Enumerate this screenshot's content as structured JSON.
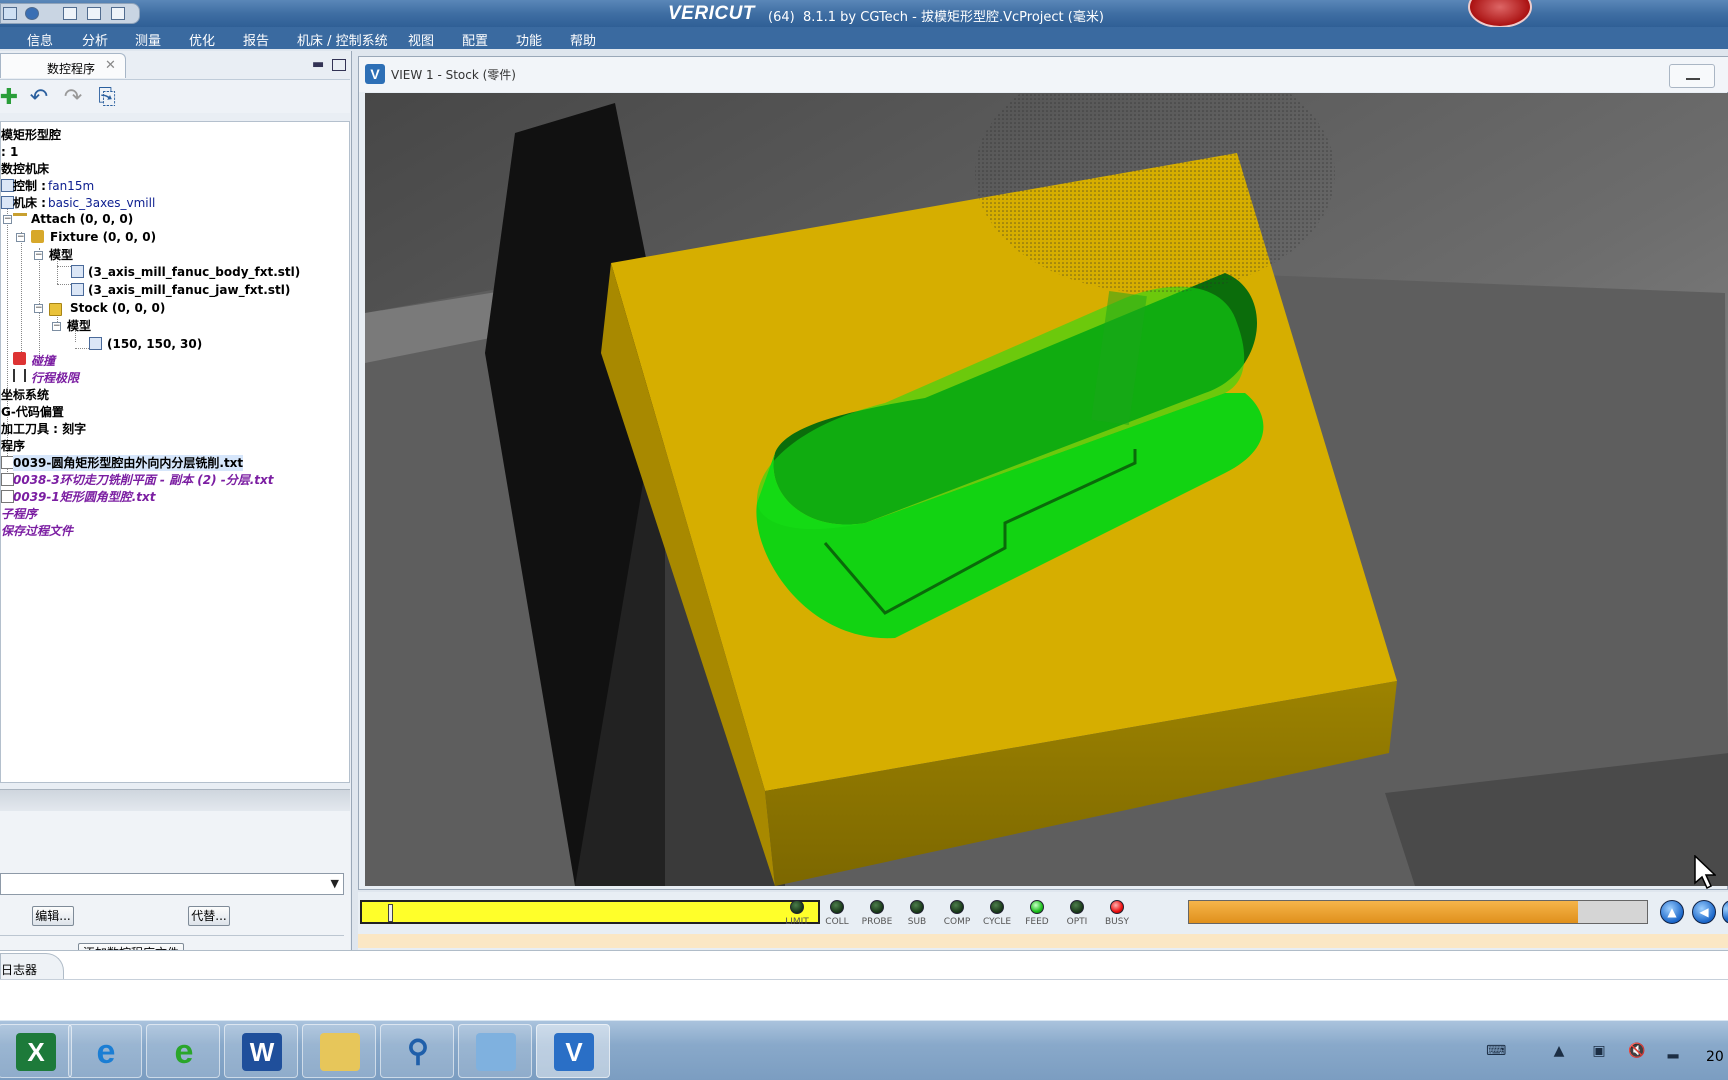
{
  "app": {
    "brand": "VERICUT",
    "title": "(64)  8.1.1 by CGTech - 拔模矩形型腔.VcProject (毫米)"
  },
  "menu": [
    "信息",
    "分析",
    "测量",
    "优化",
    "报告",
    "机床 / 控制系统",
    "视图",
    "配置",
    "功能",
    "帮助"
  ],
  "left_panel": {
    "tab_label": "数控程序",
    "tree": [
      "模矩形型腔",
      ": 1",
      "数控机床",
      "控制 : ",
      "fan15m",
      "机床 : ",
      "basic_3axes_vmill",
      "Attach (0, 0, 0)",
      "Fixture (0, 0, 0)",
      "模型",
      "(3_axis_mill_fanuc_body_fxt.stl)",
      "(3_axis_mill_fanuc_jaw_fxt.stl)",
      "Stock (0, 0, 0)",
      "模型",
      "(150, 150, 30)",
      "碰撞",
      "行程极限",
      "坐标系统",
      "G-代码偏置",
      "加工刀具 : 刻字",
      "程序",
      "0039-圆角矩形型腔由外向内分层铣削.txt",
      "0038-3环切走刀铣削平面 - 副本 (2) -分层.txt",
      "0039-1矩形圆角型腔.txt",
      "子程序",
      "保存过程文件"
    ],
    "edit_button": "编辑...",
    "replace_button": "代替...",
    "add_button": "添加数控程序文件"
  },
  "view": {
    "title": "VIEW 1 - Stock (零件)"
  },
  "status_leds": [
    {
      "label": "LIMIT",
      "state": "off"
    },
    {
      "label": "COLL",
      "state": "off"
    },
    {
      "label": "PROBE",
      "state": "off"
    },
    {
      "label": "SUB",
      "state": "off"
    },
    {
      "label": "COMP",
      "state": "off"
    },
    {
      "label": "CYCLE",
      "state": "off"
    },
    {
      "label": "FEED",
      "state": "green"
    },
    {
      "label": "OPTI",
      "state": "off"
    },
    {
      "label": "BUSY",
      "state": "red"
    }
  ],
  "simulation": {
    "progress_fraction": 0.85
  },
  "logger": {
    "tab_label": "日志器"
  },
  "taskbar": {
    "apps": [
      "excel-icon",
      "internet-explorer-icon",
      "ie-green-icon",
      "word-icon",
      "file-explorer-icon",
      "search-tool-icon",
      "notepad-icon",
      "vericut-icon"
    ],
    "clock": "20"
  },
  "colors": {
    "accent": "#3a6aa0",
    "stock": "#d6ae00",
    "cut": "#12d312",
    "progress": "#f2b449"
  }
}
